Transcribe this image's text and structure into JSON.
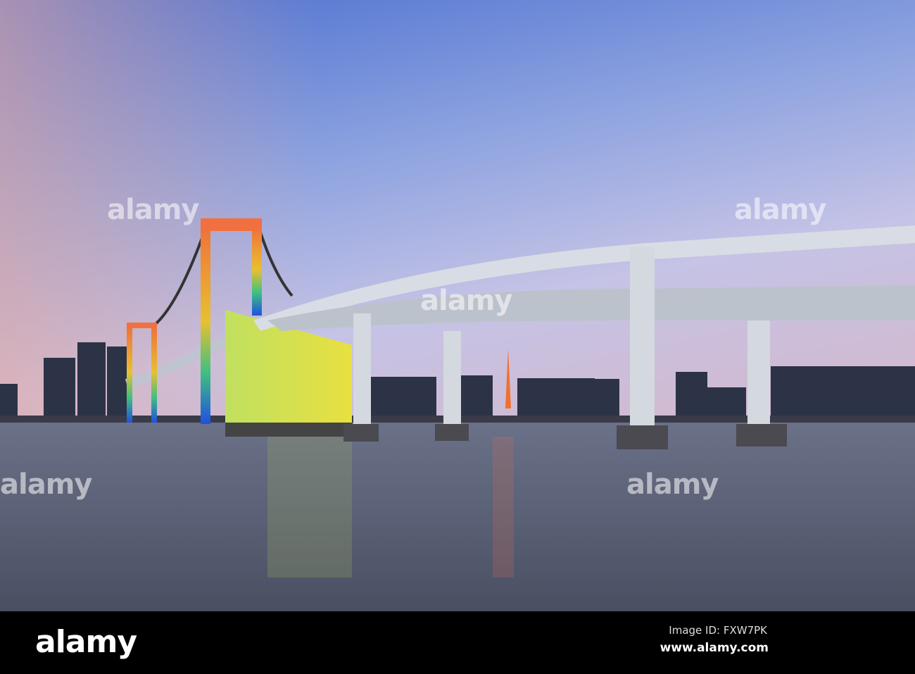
{
  "watermark": "alamy",
  "footer": {
    "logo": "alamy",
    "image_id": "Image ID: FXW7PK",
    "website": "www.alamy.com"
  }
}
